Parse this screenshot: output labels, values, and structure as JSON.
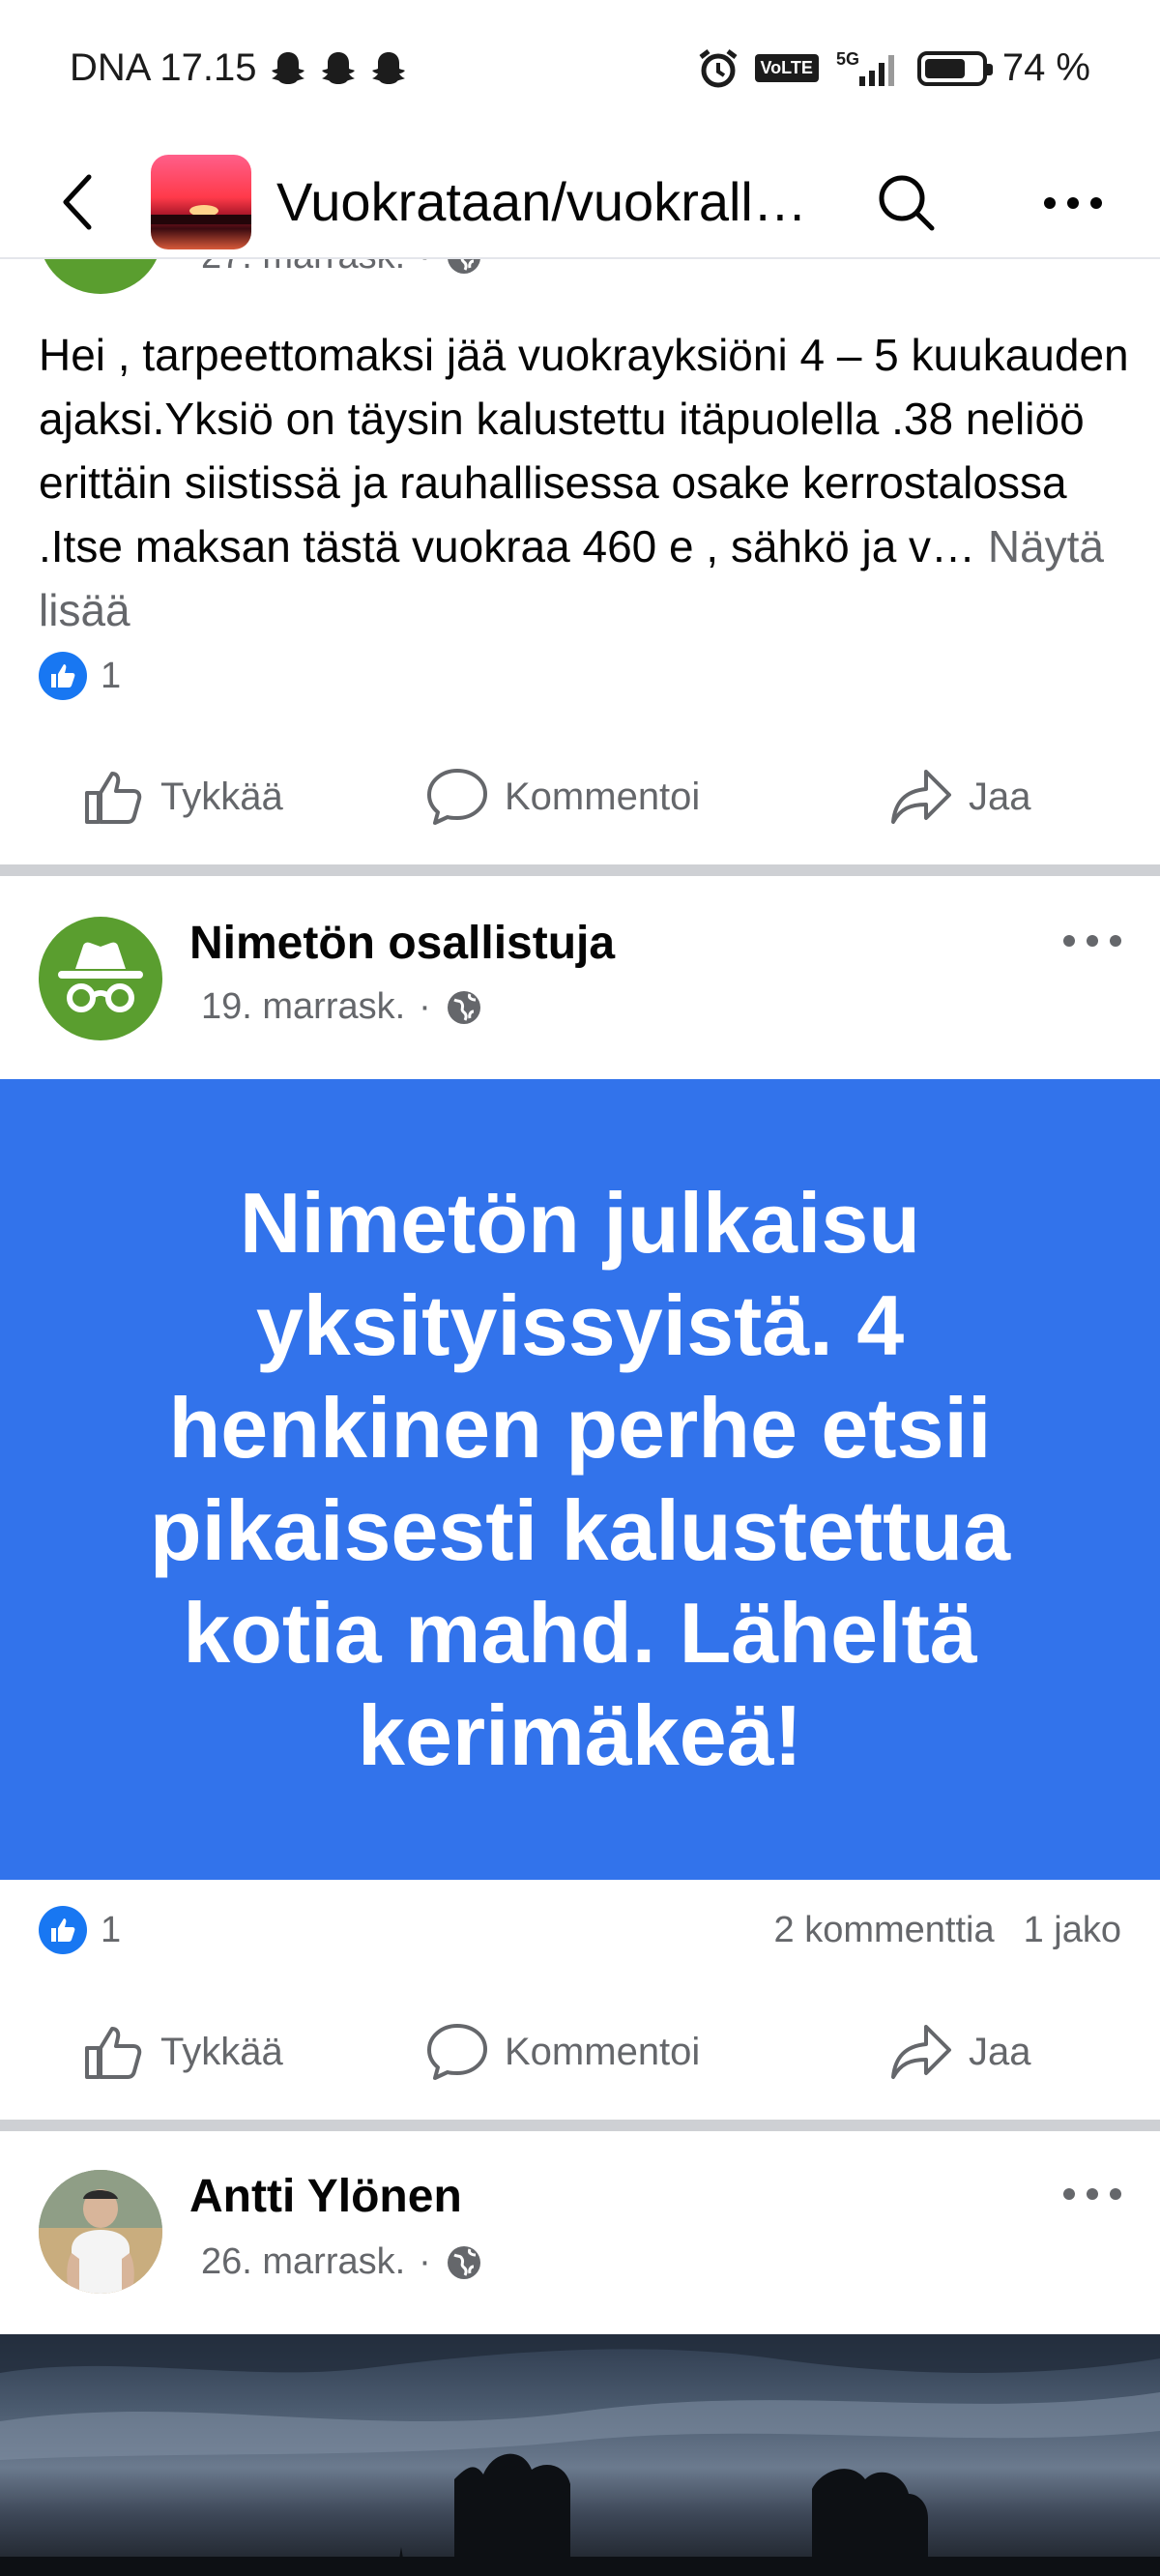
{
  "status_bar": {
    "carrier_time": "DNA 17.15",
    "network": "5G",
    "battery_percent": "74 %",
    "battery_level": 0.74,
    "icons": [
      "snapchat-ghost-icon",
      "snapchat-ghost-icon",
      "snapchat-ghost-icon",
      "alarm-icon",
      "volte-icon",
      "signal-icon",
      "battery-icon"
    ]
  },
  "header": {
    "title": "Vuokrataan/vuokrall…",
    "back_icon": "chevron-left-icon",
    "search_icon": "search-icon",
    "more_icon": "more-horizontal-icon"
  },
  "post1": {
    "date": "27. marrask.",
    "text": "Hei , tarpeettomaksi jää vuokrayksiöni 4 – 5 kuukauden ajaksi.Yksiö  on  täysin kalustettu itäpuolella .38 neliöö erittäin siistissä ja rauhallisessa osake kerrostalossa .Itse maksan tästä vuokraa  460 e , sähkö ja  v…",
    "see_more": "Näytä lisää",
    "likes": "1"
  },
  "post2": {
    "author": "Nimetön osallistuja",
    "date": "19. marrask.",
    "body": "Nimetön julkaisu yksityissyistä. 4 henkinen perhe etsii pikaisesti kalustettua kotia mahd. Läheltä kerimäkeä!",
    "background_color": "#3273eb",
    "likes": "1",
    "comments": "2 kommenttia",
    "shares": "1 jako"
  },
  "post3": {
    "author": "Antti Ylönen",
    "date": "26. marrask."
  },
  "actions": {
    "like": "Tykkää",
    "comment": "Kommentoi",
    "share": "Jaa"
  },
  "separator": "·"
}
